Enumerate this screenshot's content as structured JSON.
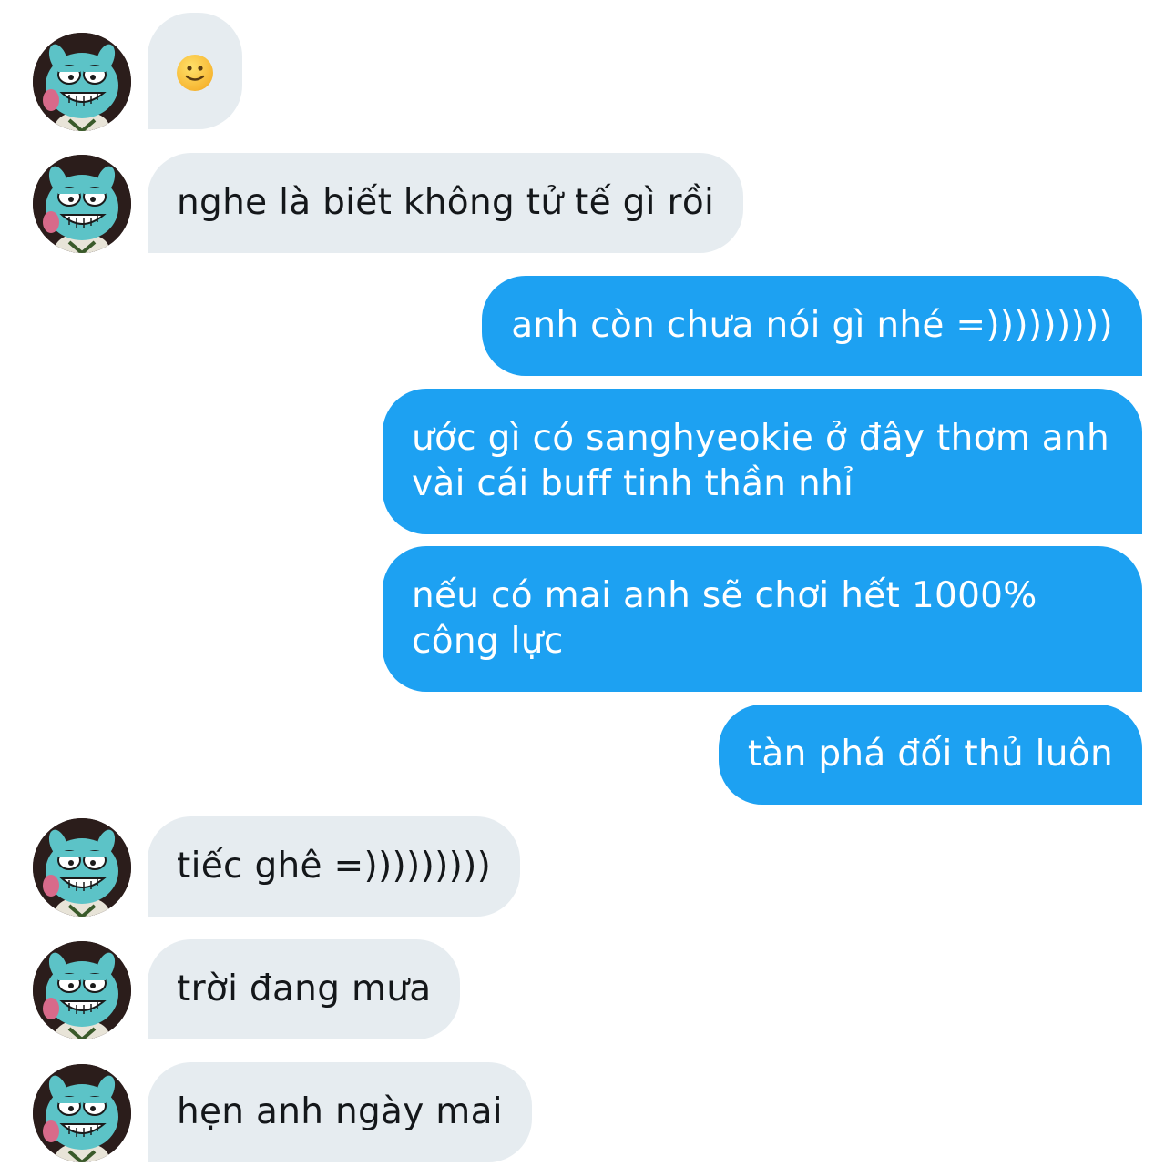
{
  "conversation": {
    "contact_avatar": "gumball-avatar-icon",
    "colors": {
      "incoming_bubble": "#e6ecf0",
      "outgoing_bubble": "#1da1f2",
      "incoming_text": "#14171a",
      "outgoing_text": "#ffffff"
    },
    "messages": [
      {
        "direction": "incoming",
        "text": "🙂",
        "emoji_icon": "slightly-smiling-face-icon"
      },
      {
        "direction": "incoming",
        "text": "nghe là biết không tử tế gì rồi"
      },
      {
        "direction": "outgoing",
        "text": "anh còn chưa nói gì nhé =)))))))))"
      },
      {
        "direction": "outgoing",
        "text": "ước gì có sanghyeokie ở đây thơm anh vài cái buff tinh thần nhỉ"
      },
      {
        "direction": "outgoing",
        "text": "nếu có mai anh sẽ chơi hết 1000% công lực"
      },
      {
        "direction": "outgoing",
        "text": "tàn phá đối thủ luôn"
      },
      {
        "direction": "incoming",
        "text": "tiếc ghê =)))))))))"
      },
      {
        "direction": "incoming",
        "text": "trời đang mưa"
      },
      {
        "direction": "incoming",
        "text": "hẹn anh ngày mai"
      }
    ]
  }
}
